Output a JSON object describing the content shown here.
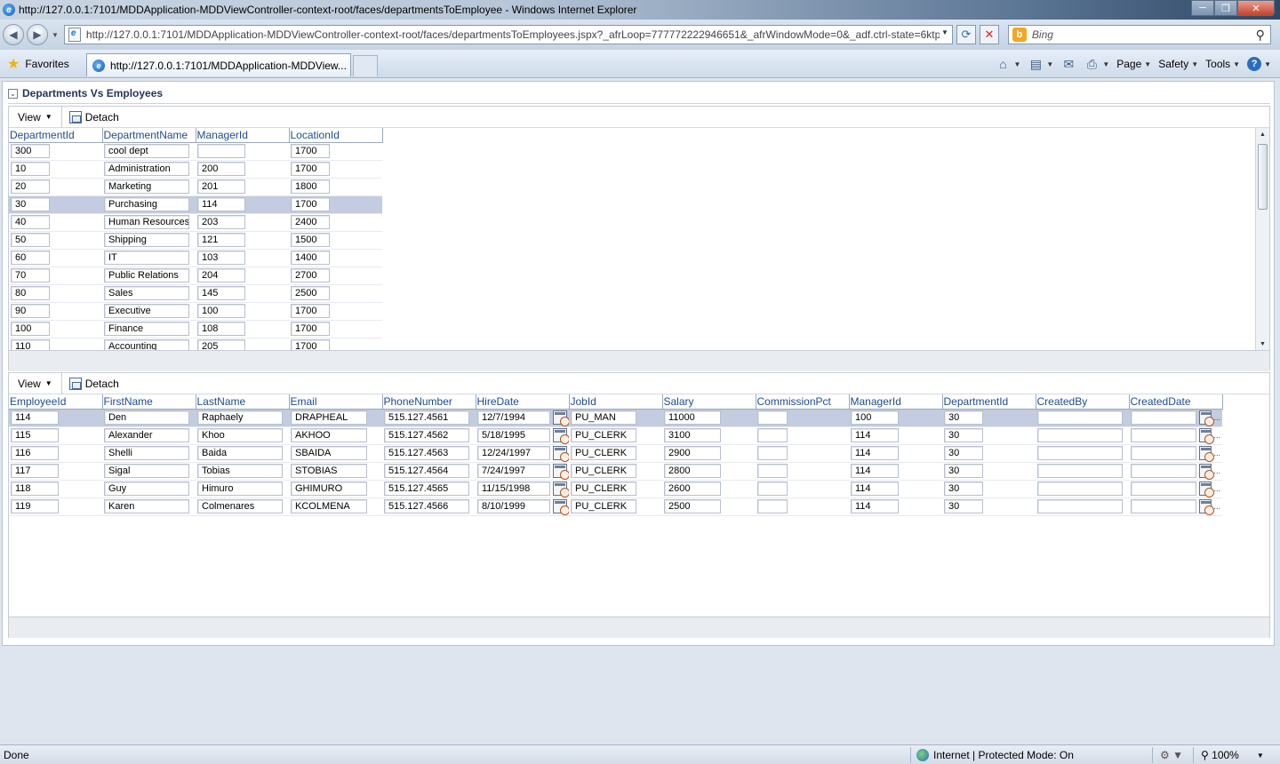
{
  "window": {
    "title": "http://127.0.0.1:7101/MDDApplication-MDDViewController-context-root/faces/departmentsToEmployee - Windows Internet Explorer",
    "minimize": "─",
    "maximize": "❐",
    "close": "✕"
  },
  "address": {
    "url": "http://127.0.0.1:7101/MDDApplication-MDDViewController-context-root/faces/departmentsToEmployees.jspx?_afrLoop=777772222946651&_afrWindowMode=0&_adf.ctrl-state=6ktp",
    "search_placeholder": "Bing"
  },
  "favorites": {
    "label": "Favorites"
  },
  "tab": {
    "title": "http://127.0.0.1:7101/MDDApplication-MDDView..."
  },
  "commandbar": {
    "page": "Page",
    "safety": "Safety",
    "tools": "Tools",
    "help": "?"
  },
  "panel": {
    "title": "Departments Vs Employees"
  },
  "toolbar": {
    "view": "View",
    "detach": "Detach"
  },
  "departments": {
    "columns": [
      "DepartmentId",
      "DepartmentName",
      "ManagerId",
      "LocationId"
    ],
    "rows": [
      [
        "300",
        "cool dept",
        "",
        "1700"
      ],
      [
        "10",
        "Administration",
        "200",
        "1700"
      ],
      [
        "20",
        "Marketing",
        "201",
        "1800"
      ],
      [
        "30",
        "Purchasing",
        "114",
        "1700"
      ],
      [
        "40",
        "Human Resources",
        "203",
        "2400"
      ],
      [
        "50",
        "Shipping",
        "121",
        "1500"
      ],
      [
        "60",
        "IT",
        "103",
        "1400"
      ],
      [
        "70",
        "Public Relations",
        "204",
        "2700"
      ],
      [
        "80",
        "Sales",
        "145",
        "2500"
      ],
      [
        "90",
        "Executive",
        "100",
        "1700"
      ],
      [
        "100",
        "Finance",
        "108",
        "1700"
      ],
      [
        "110",
        "Accounting",
        "205",
        "1700"
      ]
    ],
    "selected_row": 3
  },
  "employees": {
    "columns": [
      "EmployeeId",
      "FirstName",
      "LastName",
      "Email",
      "PhoneNumber",
      "HireDate",
      "JobId",
      "Salary",
      "CommissionPct",
      "ManagerId",
      "DepartmentId",
      "CreatedBy",
      "CreatedDate"
    ],
    "rows": [
      [
        "114",
        "Den",
        "Raphaely",
        "DRAPHEAL",
        "515.127.4561",
        "12/7/1994",
        "PU_MAN",
        "11000",
        "",
        "100",
        "30",
        "",
        ""
      ],
      [
        "115",
        "Alexander",
        "Khoo",
        "AKHOO",
        "515.127.4562",
        "5/18/1995",
        "PU_CLERK",
        "3100",
        "",
        "114",
        "30",
        "",
        ""
      ],
      [
        "116",
        "Shelli",
        "Baida",
        "SBAIDA",
        "515.127.4563",
        "12/24/1997",
        "PU_CLERK",
        "2900",
        "",
        "114",
        "30",
        "",
        ""
      ],
      [
        "117",
        "Sigal",
        "Tobias",
        "STOBIAS",
        "515.127.4564",
        "7/24/1997",
        "PU_CLERK",
        "2800",
        "",
        "114",
        "30",
        "",
        ""
      ],
      [
        "118",
        "Guy",
        "Himuro",
        "GHIMURO",
        "515.127.4565",
        "11/15/1998",
        "PU_CLERK",
        "2600",
        "",
        "114",
        "30",
        "",
        ""
      ],
      [
        "119",
        "Karen",
        "Colmenares",
        "KCOLMENA",
        "515.127.4566",
        "8/10/1999",
        "PU_CLERK",
        "2500",
        "",
        "114",
        "30",
        "",
        ""
      ]
    ],
    "selected_row": 0,
    "ellipsis": "..."
  },
  "status": {
    "left": "Done",
    "zone": "Internet | Protected Mode: On",
    "zoom": "100%"
  }
}
